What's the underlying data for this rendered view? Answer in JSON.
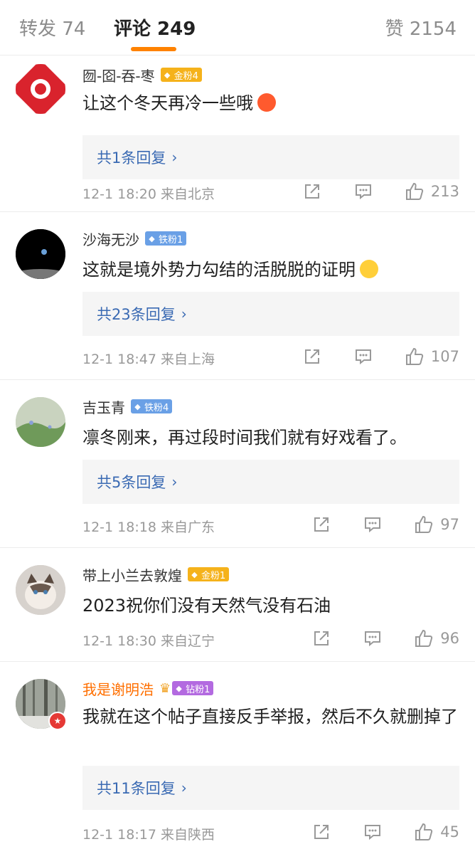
{
  "tabs": {
    "forward_label": "转发 74",
    "comments_label": "评论 249",
    "likes_label": "赞 2154"
  },
  "colors": {
    "accent": "#ff8200",
    "link": "#3a6ab3",
    "vip_name": "#ff6f00"
  },
  "comments": [
    {
      "name": "囫-囵-吞-枣",
      "badge": "金粉4",
      "badge_type": "gold",
      "text": "让这个冬天再冷一些哦",
      "emoji": "angry-face-icon",
      "reply": "共1条回复",
      "meta": "12-1 18:20 来自北京",
      "likes": "213"
    },
    {
      "name": "沙海无沙",
      "badge": "铁粉1",
      "badge_type": "iron",
      "text": "这就是境外势力勾结的活脱脱的证明",
      "emoji": "thinking-face-icon",
      "reply": "共23条回复",
      "meta": "12-1 18:47 来自上海",
      "likes": "107"
    },
    {
      "name": "吉玉青",
      "badge": "铁粉4",
      "badge_type": "iron",
      "text": "凛冬刚来，再过段时间我们就有好戏看了。",
      "reply": "共5条回复",
      "meta": "12-1 18:18 来自广东",
      "likes": "97"
    },
    {
      "name": "带上小兰去敦煌",
      "badge": "金粉1",
      "badge_type": "gold",
      "text": "2023祝你们没有天然气没有石油",
      "meta": "12-1 18:30 来自辽宁",
      "likes": "96"
    },
    {
      "name": "我是谢明浩",
      "badge": "钻粉1",
      "badge_type": "drill",
      "text": "我就在这个帖子直接反手举报，然后不久就删掉了",
      "reply": "共11条回复",
      "meta": "12-1 18:17 来自陕西",
      "likes": "45"
    }
  ]
}
